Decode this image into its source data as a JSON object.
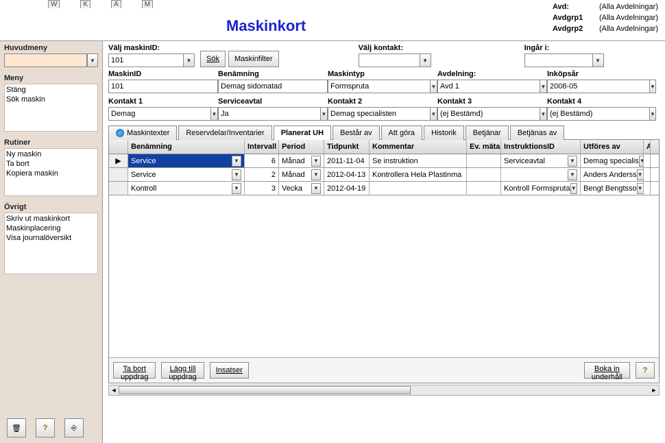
{
  "header": {
    "title": "Maskinkort",
    "tab_hotkeys": [
      "W",
      "K",
      "A",
      "M"
    ],
    "avd": [
      {
        "label": "Avd:",
        "value": "(Alla Avdelningar)"
      },
      {
        "label": "Avdgrp1",
        "value": "(Alla Avdelningar)"
      },
      {
        "label": "Avdgrp2",
        "value": "(Alla Avdelningar)"
      }
    ]
  },
  "sidebar": {
    "sections": {
      "huvudmeny": {
        "title": "Huvudmeny",
        "combo_value": ""
      },
      "meny": {
        "title": "Meny",
        "items": [
          "Stäng",
          "Sök maskin"
        ]
      },
      "rutiner": {
        "title": "Rutiner",
        "items": [
          "Ny maskin",
          "Ta bort",
          "Kopiera maskin"
        ]
      },
      "ovrigt": {
        "title": "Övrigt",
        "items": [
          "Skriv ut maskinkort",
          "Maskinplacering",
          "Visa journalöversikt"
        ]
      }
    },
    "icon_buttons": [
      "trash",
      "help",
      "exit"
    ]
  },
  "filters": {
    "valj_maskin_id": {
      "label": "Välj maskinID:",
      "value": "101",
      "sok": "Sök",
      "maskinfilter": "Maskinfilter"
    },
    "valj_kontakt": {
      "label": "Välj kontakt:",
      "value": ""
    },
    "ingar_i": {
      "label": "Ingår i:",
      "value": ""
    }
  },
  "details": {
    "row1": [
      {
        "label": "MaskinID",
        "value": "101",
        "dropdown": false
      },
      {
        "label": "Benämning",
        "value": "Demag sidomatad",
        "dropdown": false
      },
      {
        "label": "Maskintyp",
        "value": "Formspruta",
        "dropdown": true
      },
      {
        "label": "Avdelning:",
        "value": "Avd 1",
        "dropdown": true
      },
      {
        "label": "Inköpsår",
        "value": "2008-05",
        "dropdown": true
      }
    ],
    "row2": [
      {
        "label": "Kontakt 1",
        "value": "Demag",
        "dropdown": true
      },
      {
        "label": "Serviceavtal",
        "value": "Ja",
        "dropdown": true
      },
      {
        "label": "Kontakt 2",
        "value": "Demag specialisten",
        "dropdown": true
      },
      {
        "label": "Kontakt 3",
        "value": "(ej Bestämd)",
        "dropdown": true
      },
      {
        "label": "Kontakt 4",
        "value": "(ej Bestämd)",
        "dropdown": true
      }
    ]
  },
  "tabs": [
    "Maskintexter",
    "Reservdelar/Inventarier",
    "Planerat UH",
    "Består av",
    "Att göra",
    "Historik",
    "Betjänar",
    "Betjänas av"
  ],
  "active_tab": 2,
  "grid": {
    "columns": [
      "Benämning",
      "Intervall",
      "Period",
      "Tidpunkt",
      "Kommentar",
      "Ev. mätarst.",
      "InstruktionsID",
      "Utföres av",
      "A [t"
    ],
    "rows": [
      {
        "name": "Service",
        "interval": "6",
        "period": "Månad",
        "tidpunkt": "2011-11-04",
        "kommentar": "Se instruktion",
        "ev": "",
        "instr": "Serviceavtal",
        "utf": "Demag specialis",
        "selected": true
      },
      {
        "name": "Service",
        "interval": "2",
        "period": "Månad",
        "tidpunkt": "2012-04-13",
        "kommentar": "Kontrollera Hela Plastinma",
        "ev": "",
        "instr": "",
        "utf": "Anders Anderss",
        "selected": false
      },
      {
        "name": "Kontroll",
        "interval": "3",
        "period": "Vecka",
        "tidpunkt": "2012-04-19",
        "kommentar": "",
        "ev": "",
        "instr": "Kontroll Formspruta",
        "utf": "Bengt Bengtsso",
        "selected": false
      }
    ],
    "footer": {
      "ta_bort1": "Ta bort",
      "ta_bort2": "uppdrag",
      "lagg1": "Lägg till",
      "lagg2": "uppdrag",
      "insatser": "Insatser",
      "boka1": "Boka in",
      "boka2": "underhåll",
      "help": "?"
    }
  }
}
